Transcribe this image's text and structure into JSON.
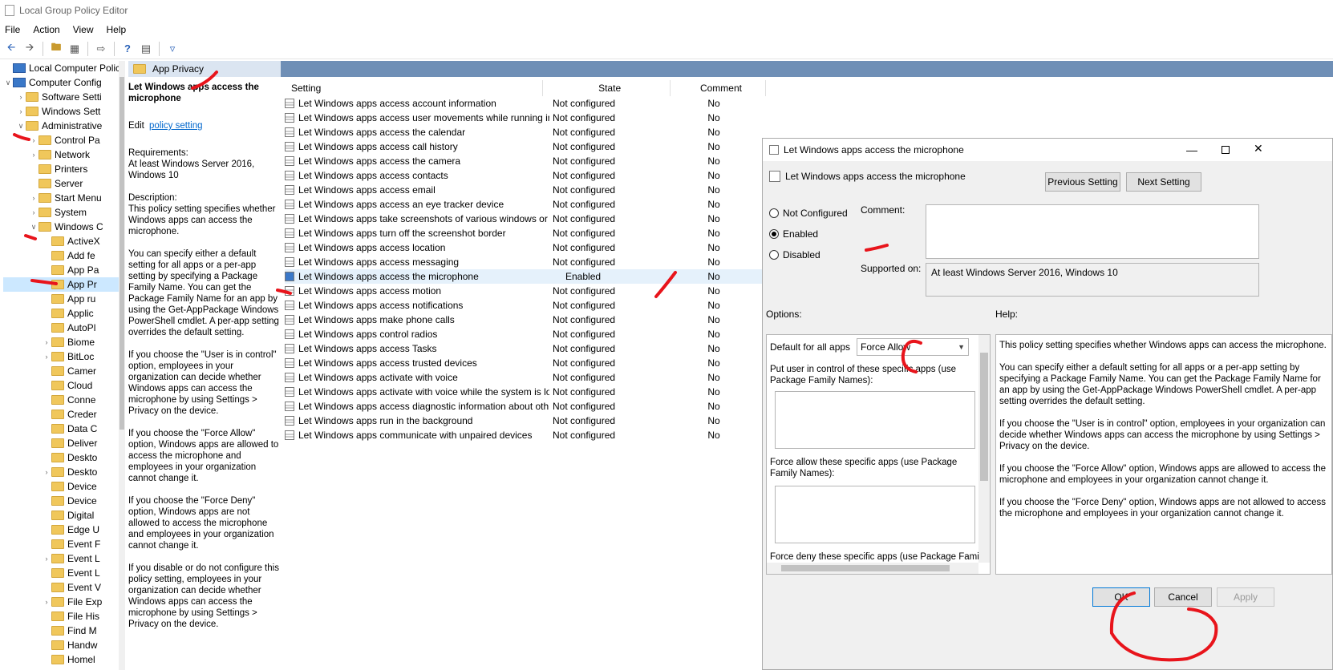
{
  "app": {
    "title": "Local Group Policy Editor"
  },
  "menu": [
    "File",
    "Action",
    "View",
    "Help"
  ],
  "tree": [
    {
      "label": "Local Computer Polic",
      "depth": 0,
      "arrow": "",
      "icon": "comp"
    },
    {
      "label": "Computer Config",
      "depth": 0,
      "arrow": "v",
      "icon": "comp"
    },
    {
      "label": "Software Setti",
      "depth": 1,
      "arrow": ">",
      "icon": "fold"
    },
    {
      "label": "Windows Sett",
      "depth": 1,
      "arrow": ">",
      "icon": "fold"
    },
    {
      "label": "Administrative",
      "depth": 1,
      "arrow": "v",
      "icon": "fold"
    },
    {
      "label": "Control Pa",
      "depth": 2,
      "arrow": ">",
      "icon": "fold"
    },
    {
      "label": "Network",
      "depth": 2,
      "arrow": ">",
      "icon": "fold"
    },
    {
      "label": "Printers",
      "depth": 2,
      "arrow": "",
      "icon": "fold"
    },
    {
      "label": "Server",
      "depth": 2,
      "arrow": "",
      "icon": "fold"
    },
    {
      "label": "Start Menu",
      "depth": 2,
      "arrow": ">",
      "icon": "fold"
    },
    {
      "label": "System",
      "depth": 2,
      "arrow": ">",
      "icon": "fold"
    },
    {
      "label": "Windows C",
      "depth": 2,
      "arrow": "v",
      "icon": "fold"
    },
    {
      "label": "ActiveX",
      "depth": 3,
      "arrow": "",
      "icon": "fold"
    },
    {
      "label": "Add fe",
      "depth": 3,
      "arrow": "",
      "icon": "fold"
    },
    {
      "label": "App Pa",
      "depth": 3,
      "arrow": "",
      "icon": "fold"
    },
    {
      "label": "App Pr",
      "depth": 3,
      "arrow": "",
      "icon": "fold",
      "selected": true
    },
    {
      "label": "App ru",
      "depth": 3,
      "arrow": "",
      "icon": "fold"
    },
    {
      "label": "Applic",
      "depth": 3,
      "arrow": "",
      "icon": "fold"
    },
    {
      "label": "AutoPl",
      "depth": 3,
      "arrow": "",
      "icon": "fold"
    },
    {
      "label": "Biome",
      "depth": 3,
      "arrow": ">",
      "icon": "fold"
    },
    {
      "label": "BitLoc",
      "depth": 3,
      "arrow": ">",
      "icon": "fold"
    },
    {
      "label": "Camer",
      "depth": 3,
      "arrow": "",
      "icon": "fold"
    },
    {
      "label": "Cloud",
      "depth": 3,
      "arrow": "",
      "icon": "fold"
    },
    {
      "label": "Conne",
      "depth": 3,
      "arrow": "",
      "icon": "fold"
    },
    {
      "label": "Creder",
      "depth": 3,
      "arrow": "",
      "icon": "fold"
    },
    {
      "label": "Data C",
      "depth": 3,
      "arrow": "",
      "icon": "fold"
    },
    {
      "label": "Deliver",
      "depth": 3,
      "arrow": "",
      "icon": "fold"
    },
    {
      "label": "Deskto",
      "depth": 3,
      "arrow": "",
      "icon": "fold"
    },
    {
      "label": "Deskto",
      "depth": 3,
      "arrow": ">",
      "icon": "fold"
    },
    {
      "label": "Device",
      "depth": 3,
      "arrow": "",
      "icon": "fold"
    },
    {
      "label": "Device",
      "depth": 3,
      "arrow": "",
      "icon": "fold"
    },
    {
      "label": "Digital",
      "depth": 3,
      "arrow": "",
      "icon": "fold"
    },
    {
      "label": "Edge U",
      "depth": 3,
      "arrow": "",
      "icon": "fold"
    },
    {
      "label": "Event F",
      "depth": 3,
      "arrow": "",
      "icon": "fold"
    },
    {
      "label": "Event L",
      "depth": 3,
      "arrow": ">",
      "icon": "fold"
    },
    {
      "label": "Event L",
      "depth": 3,
      "arrow": "",
      "icon": "fold"
    },
    {
      "label": "Event V",
      "depth": 3,
      "arrow": "",
      "icon": "fold"
    },
    {
      "label": "File Exp",
      "depth": 3,
      "arrow": ">",
      "icon": "fold"
    },
    {
      "label": "File His",
      "depth": 3,
      "arrow": "",
      "icon": "fold"
    },
    {
      "label": "Find M",
      "depth": 3,
      "arrow": "",
      "icon": "fold"
    },
    {
      "label": "Handw",
      "depth": 3,
      "arrow": "",
      "icon": "fold"
    },
    {
      "label": "Homel",
      "depth": 3,
      "arrow": "",
      "icon": "fold"
    }
  ],
  "folder_header": "App Privacy",
  "description": {
    "title": "Let Windows apps access the microphone",
    "edit_prefix": "Edit",
    "edit_link": "policy setting",
    "requirements_label": "Requirements:",
    "requirements": "At least Windows Server 2016, Windows 10",
    "description_label": "Description:",
    "paragraphs": [
      "This policy setting specifies whether Windows apps can access the microphone.",
      "You can specify either a default setting for all apps or a per-app setting by specifying a Package Family Name. You can get the Package Family Name for an app by using the Get-AppPackage Windows PowerShell cmdlet. A per-app setting overrides the default setting.",
      "If you choose the \"User is in control\" option, employees in your organization can decide whether Windows apps can access the microphone by using Settings > Privacy on the device.",
      "If you choose the \"Force Allow\" option, Windows apps are allowed to access the microphone and employees in your organization cannot change it.",
      "If you choose the \"Force Deny\" option, Windows apps are not allowed to access the microphone and employees in your organization cannot change it.",
      "If you disable or do not configure this policy setting, employees in your organization can decide whether Windows apps can access the microphone by using Settings > Privacy on the device."
    ]
  },
  "list": {
    "headers": [
      "Setting",
      "State",
      "Comment"
    ],
    "rows": [
      {
        "setting": "Let Windows apps access account information",
        "state": "Not configured",
        "comment": "No"
      },
      {
        "setting": "Let Windows apps access user movements while running in ...",
        "state": "Not configured",
        "comment": "No"
      },
      {
        "setting": "Let Windows apps access the calendar",
        "state": "Not configured",
        "comment": "No"
      },
      {
        "setting": "Let Windows apps access call history",
        "state": "Not configured",
        "comment": "No"
      },
      {
        "setting": "Let Windows apps access the camera",
        "state": "Not configured",
        "comment": "No"
      },
      {
        "setting": "Let Windows apps access contacts",
        "state": "Not configured",
        "comment": "No"
      },
      {
        "setting": "Let Windows apps access email",
        "state": "Not configured",
        "comment": "No"
      },
      {
        "setting": "Let Windows apps access an eye tracker device",
        "state": "Not configured",
        "comment": "No"
      },
      {
        "setting": "Let Windows apps take screenshots of various windows or d...",
        "state": "Not configured",
        "comment": "No"
      },
      {
        "setting": "Let Windows apps turn off the screenshot border",
        "state": "Not configured",
        "comment": "No"
      },
      {
        "setting": "Let Windows apps access location",
        "state": "Not configured",
        "comment": "No"
      },
      {
        "setting": "Let Windows apps access messaging",
        "state": "Not configured",
        "comment": "No"
      },
      {
        "setting": "Let Windows apps access the microphone",
        "state": "Enabled",
        "comment": "No",
        "selected": true
      },
      {
        "setting": "Let Windows apps access motion",
        "state": "Not configured",
        "comment": "No"
      },
      {
        "setting": "Let Windows apps access notifications",
        "state": "Not configured",
        "comment": "No"
      },
      {
        "setting": "Let Windows apps make phone calls",
        "state": "Not configured",
        "comment": "No"
      },
      {
        "setting": "Let Windows apps control radios",
        "state": "Not configured",
        "comment": "No"
      },
      {
        "setting": "Let Windows apps access Tasks",
        "state": "Not configured",
        "comment": "No"
      },
      {
        "setting": "Let Windows apps access trusted devices",
        "state": "Not configured",
        "comment": "No"
      },
      {
        "setting": "Let Windows apps activate with voice",
        "state": "Not configured",
        "comment": "No"
      },
      {
        "setting": "Let Windows apps activate with voice while the system is lo...",
        "state": "Not configured",
        "comment": "No"
      },
      {
        "setting": "Let Windows apps access diagnostic information about oth...",
        "state": "Not configured",
        "comment": "No"
      },
      {
        "setting": "Let Windows apps run in the background",
        "state": "Not configured",
        "comment": "No"
      },
      {
        "setting": "Let Windows apps communicate with unpaired devices",
        "state": "Not configured",
        "comment": "No"
      }
    ]
  },
  "dialog": {
    "title": "Let Windows apps access the microphone",
    "subtitle": "Let Windows apps access the microphone",
    "prev_button": "Previous Setting",
    "next_button": "Next Setting",
    "radio_not_configured": "Not Configured",
    "radio_enabled": "Enabled",
    "radio_disabled": "Disabled",
    "selected_radio": "Enabled",
    "comment_label": "Comment:",
    "supported_label": "Supported on:",
    "supported_value": "At least Windows Server 2016, Windows 10",
    "options_label": "Options:",
    "help_label": "Help:",
    "default_label": "Default for all apps",
    "default_value": "Force Allow",
    "put_user_label": "Put user in control of these specific apps (use Package Family Names):",
    "force_allow_label": "Force allow these specific apps (use Package Family Names):",
    "force_deny_label": "Force deny these specific apps (use Package Family",
    "help_paragraphs": [
      "This policy setting specifies whether Windows apps can access the microphone.",
      "You can specify either a default setting for all apps or a per-app setting by specifying a Package Family Name. You can get the Package Family Name for an app by using the Get-AppPackage Windows PowerShell cmdlet. A per-app setting overrides the default setting.",
      "If you choose the \"User is in control\" option, employees in your organization can decide whether Windows apps can access the microphone by using Settings > Privacy on the device.",
      "If you choose the \"Force Allow\" option, Windows apps are allowed to access the microphone and employees in your organization cannot change it.",
      "If you choose the \"Force Deny\" option, Windows apps are not allowed to access the microphone and employees in your organization cannot change it."
    ],
    "ok_button": "OK",
    "cancel_button": "Cancel",
    "apply_button": "Apply"
  },
  "colors": {
    "annotation": "#e8141b",
    "header_bar": "#6f8fb6",
    "link": "#0066cc"
  }
}
